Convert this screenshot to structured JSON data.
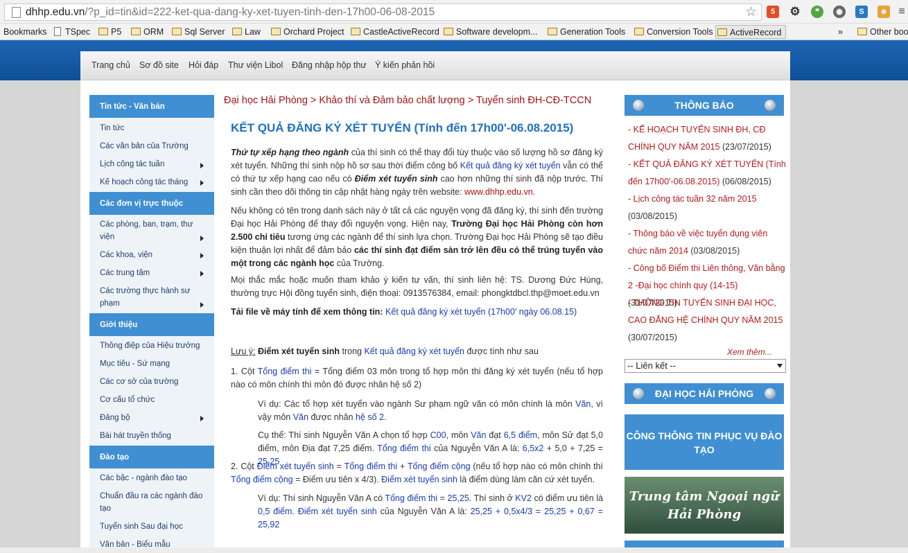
{
  "browser": {
    "url_host": "dhhp.edu.vn",
    "url_path": "/?p_id=tin&id=222-ket-qua-dang-ky-xet-tuyen-tinh-den-17h00-06-08-2015",
    "bookmarks": [
      "Bookmarks",
      "TSpec",
      "P5",
      "ORM",
      "Sql Server",
      "Law",
      "Orchard Project",
      "CastleActiveRecord",
      "Software developm...",
      "Generation Tools",
      "Conversion Tools",
      "ActiveRecord",
      "»",
      "Other boo"
    ]
  },
  "topnav": [
    "Trang chủ",
    "Sơ đồ site",
    "Hỏi đáp",
    "Thư viện Libol",
    "Đăng nhập hộp thư",
    "Ý kiến phản hồi"
  ],
  "sidebar": {
    "sections": [
      "Tin tức - Văn bản",
      "Các đơn vị trực thuộc",
      "Giới thiệu",
      "Đào tạo"
    ],
    "items": [
      "Tin tức",
      "Các văn bản của Trường",
      "Lịch công tác tuần",
      "Kế hoạch công tác tháng",
      "Các phòng, ban, trạm, thư viện",
      "Các khoa, viện",
      "Các trung tâm",
      "Các trường thực hành sư phạm",
      "Thông điệp của Hiệu trưởng",
      "Mục tiêu - Sứ mạng",
      "Các cơ sở của trường",
      "Cơ cấu tổ chức",
      "Đảng bộ",
      "Bài hát truyền thống",
      "Các bậc - ngành đào tạo",
      "Chuẩn đầu ra các ngành đào tạo",
      "Tuyển sinh Sau đại học",
      "Văn bản - Biểu mẫu"
    ]
  },
  "breadcrumb": "Đại học Hải Phòng > Khảo thí và Đảm bảo chất lượng > Tuyển sinh ĐH-CĐ-TCCN",
  "article": {
    "title": "KẾT QUẢ ĐĂNG KÝ XÉT TUYỂN (Tính đến 17h00'-06.08.2015)",
    "p1_lead": "Thứ tự xếp hạng theo ngành",
    "p1_a": " của thí sinh có thể thay đổi tùy thuộc vào số lượng hồ sơ đăng ký xét tuyển. Những thí sinh nộp hồ sơ sau thời điểm công bố ",
    "p1_link": "Kết quả đăng ký xét tuyển",
    "p1_b": " vẫn có thể có thứ tự xếp hạng cao nếu có ",
    "p1_bold": "Điểm xét tuyển sinh",
    "p1_c": " cao hơn những thí sinh đã nộp trước. Thí sinh cần theo dõi thông tin cập nhật hàng ngày trên website: ",
    "p1_site": "www.dhhp.edu.vn",
    "p1_end": ".",
    "p2_a": "Nếu không có tên trong danh sách này ở tất cả các nguyện vọng đã đăng ký, thí sinh đến trường Đại học Hải Phòng để thay đổi nguyện vọng. Hiện nay, ",
    "p2_bold1": "Trường Đại học Hải Phòng còn hơn 2.500 chỉ tiêu",
    "p2_b": " tương ứng các ngành để thí sinh lựa chọn. Trường Đại học Hải Phòng sẽ tạo điều kiện thuận lợi nhất để đảm bảo ",
    "p2_bold2": "các thí sinh đạt điểm sàn trở lên đều có thể trúng tuyển vào một trong các ngành học",
    "p2_c": " của Trường.",
    "p3": "Mọi thắc mắc hoặc muốn tham khảo ý kiến tư vấn, thí sinh liên hệ: TS. Dương Đức Hùng, thường trực Hội đồng tuyển sinh, điện thoại: 0913576384, email: phongktdbcl.thp@moet.edu.vn",
    "p4_bold": "Tải file về máy tính để xem thông tin:",
    "p4_link": " Kết quả đăng ký xét tuyển (17h00' ngày 06.08.15)",
    "note_label": "Lưu ý:",
    "note_bold": " Điểm xét tuyển sinh",
    "note_a": " trong ",
    "note_link": "Kết quả đăng ký xét tuyển",
    "note_b": " được tính như sau",
    "n1_a": "1. Cột ",
    "n1_link": "Tổng điểm thi",
    "n1_b": " = Tổng điểm 03 môn trong tổ hợp môn thi đăng ký xét tuyển (nếu tổ hợp nào có môn chính thì môn đó được nhân hệ số 2)",
    "ex1_a": "Ví dụ: Các tổ hợp xét tuyển vào ngành Sư phạm ngữ văn có môn chính là môn ",
    "ex1_l1": "Văn",
    "ex1_b": ", vì vậy môn ",
    "ex1_l2": "Văn",
    "ex1_c": " được nhân ",
    "ex1_l3": "hệ số 2",
    "ex1_d": ".",
    "ex2_a": "Cụ thể: Thí sinh Nguyễn Văn A chọn tổ hợp ",
    "ex2_l1": "C00",
    "ex2_b": ", môn ",
    "ex2_l2": "Văn",
    "ex2_c": " đạt ",
    "ex2_l3": "6,5 điểm",
    "ex2_d": ", môn Sử đạt 5,0 điểm, môn Địa đạt 7,25 điểm. ",
    "ex2_l4": "Tổng điểm thi",
    "ex2_e": " của Nguyễn Văn A là: ",
    "ex2_l5": "6,5x2",
    "ex2_f": " + 5,0 + 7,25 = ",
    "ex2_l6": "25,25",
    "n2_a": "2. Cột ",
    "n2_l1": "Điểm xét tuyển sinh",
    "n2_b": " = ",
    "n2_l2": "Tổng điểm thi",
    "n2_c": " + ",
    "n2_l3": "Tổng điểm cộng",
    "n2_d": " (nếu tổ hợp nào có môn chính thì ",
    "n2_l4": "Tổng điểm cộng",
    "n2_e": " = Điểm ưu tiên x 4/3). ",
    "n2_l5": "Điểm xét tuyển sinh",
    "n2_f": " là điểm dùng làm căn cứ xét tuyển.",
    "ex3_a": "Ví dụ: Thí sinh Nguyễn Văn A có ",
    "ex3_l1": "Tổng điểm thi",
    "ex3_b": " = ",
    "ex3_l2": "25,25",
    "ex3_c": ". Thí sinh ở ",
    "ex3_l3": "KV2",
    "ex3_d": " có điểm ưu tiên là ",
    "ex3_l4": "0,5 điểm",
    "ex3_e": ". ",
    "ex3_l5": "Điểm xét tuyển sinh",
    "ex3_f": " của Nguyễn Văn A là: ",
    "ex3_l6": "25,25 + 0,5x4/3 = 25,25 + 0,67 = 25,92"
  },
  "right": {
    "notice_title": "THÔNG BÁO",
    "notices": [
      {
        "text": "- KẾ HOẠCH TUYỂN SINH ĐH, CĐ CHÍNH QUY NĂM 2015",
        "date": "(23/07/2015)"
      },
      {
        "text": "- KẾT QUẢ ĐĂNG KÝ XÉT TUYỂN (Tính đến 17h00'-06.08.2015)",
        "date": "(06/08/2015)"
      },
      {
        "text": "- Lịch công tác tuần 32 năm 2015",
        "date": "(03/08/2015)"
      },
      {
        "text": "- Thông báo về việc tuyển dụng viên chức năm 2014",
        "date": "(03/08/2015)"
      },
      {
        "text": "- Công bố Điểm thi Liên thông, Văn bằng 2 -Đại học chính quy (14-15)",
        "date": "(31/07/2015)"
      },
      {
        "text": "- THÔNG TIN TUYỂN SINH ĐẠI HỌC, CAO ĐẲNG HỆ CHÍNH QUY NĂM 2015",
        "date": "(30/07/2015)"
      }
    ],
    "more": "Xem thêm...",
    "links_select": "-- Liên kết --",
    "dhhp_title": "ĐẠI HỌC HẢI PHÒNG",
    "portal": "CÔNG THÔNG TIN PHỤC VỤ ĐÀO TẠO",
    "lang_center": "Trung tâm Ngoại ngữ Hải Phòng"
  }
}
